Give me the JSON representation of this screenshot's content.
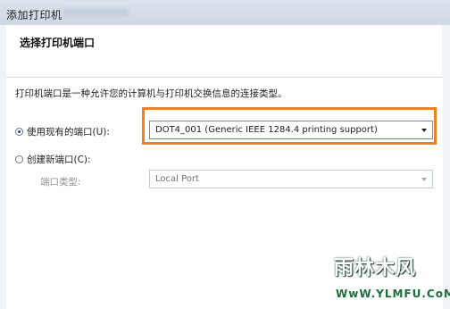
{
  "window": {
    "title": "添加打印机"
  },
  "header": {
    "heading": "选择打印机端口"
  },
  "main": {
    "description": "打印机端口是一种允许您的计算机与打印机交换信息的连接类型。",
    "use_existing": {
      "label": "使用现有的端口(U):",
      "selected": true,
      "value": "DOT4_001 (Generic IEEE 1284.4 printing support)"
    },
    "create_new": {
      "label": "创建新端口(C):",
      "selected": false
    },
    "port_type": {
      "label": "端口类型:",
      "value": "Local Port"
    }
  },
  "watermark": {
    "logo": "雨林木风",
    "url": "WwW.YLMFU.CoM"
  },
  "colors": {
    "highlight": "#f47e20",
    "header_bg": "#dbe3ec"
  }
}
